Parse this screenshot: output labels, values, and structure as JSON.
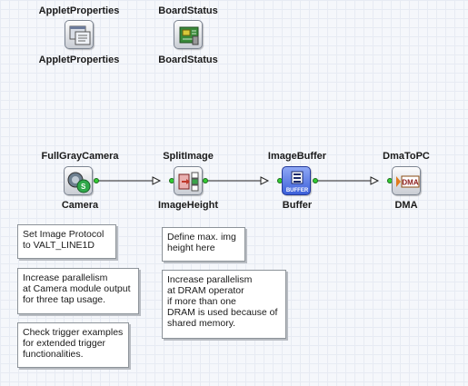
{
  "operators": {
    "applet_properties": {
      "top_label": "AppletProperties",
      "bottom_label": "AppletProperties",
      "icon": "applet-properties-icon"
    },
    "board_status": {
      "top_label": "BoardStatus",
      "bottom_label": "BoardStatus",
      "icon": "board-status-icon"
    },
    "camera": {
      "top_label": "FullGrayCamera",
      "bottom_label": "Camera",
      "icon": "camera-icon"
    },
    "split_image": {
      "top_label": "SplitImage",
      "bottom_label": "ImageHeight",
      "icon": "split-image-icon"
    },
    "image_buffer": {
      "top_label": "ImageBuffer",
      "bottom_label": "Buffer",
      "icon": "buffer-icon",
      "icon_text": "BUFFER"
    },
    "dma_to_pc": {
      "top_label": "DmaToPC",
      "bottom_label": "DMA",
      "icon": "dma-icon",
      "icon_text": "DMA"
    }
  },
  "notes": {
    "image_protocol": "Set Image Protocol\nto VALT_LINE1D",
    "parallelism_camera": "Increase parallelism\nat Camera module output\nfor three tap usage.",
    "trigger_examples": "Check trigger examples\nfor extended trigger\nfunctionalities.",
    "max_img_height": "Define max. img\nheight here",
    "parallelism_dram": "Increase parallelism\nat DRAM operator\nif more than one\nDRAM is used because of\nshared memory."
  },
  "colors": {
    "canvas_background": "#f5f7fb",
    "grid_line": "#e7ebf3",
    "port": "#33cc33",
    "buffer_accent": "#3b5fd9",
    "dma_accent": "#e07a1c",
    "split_accent": "#c0392b"
  }
}
